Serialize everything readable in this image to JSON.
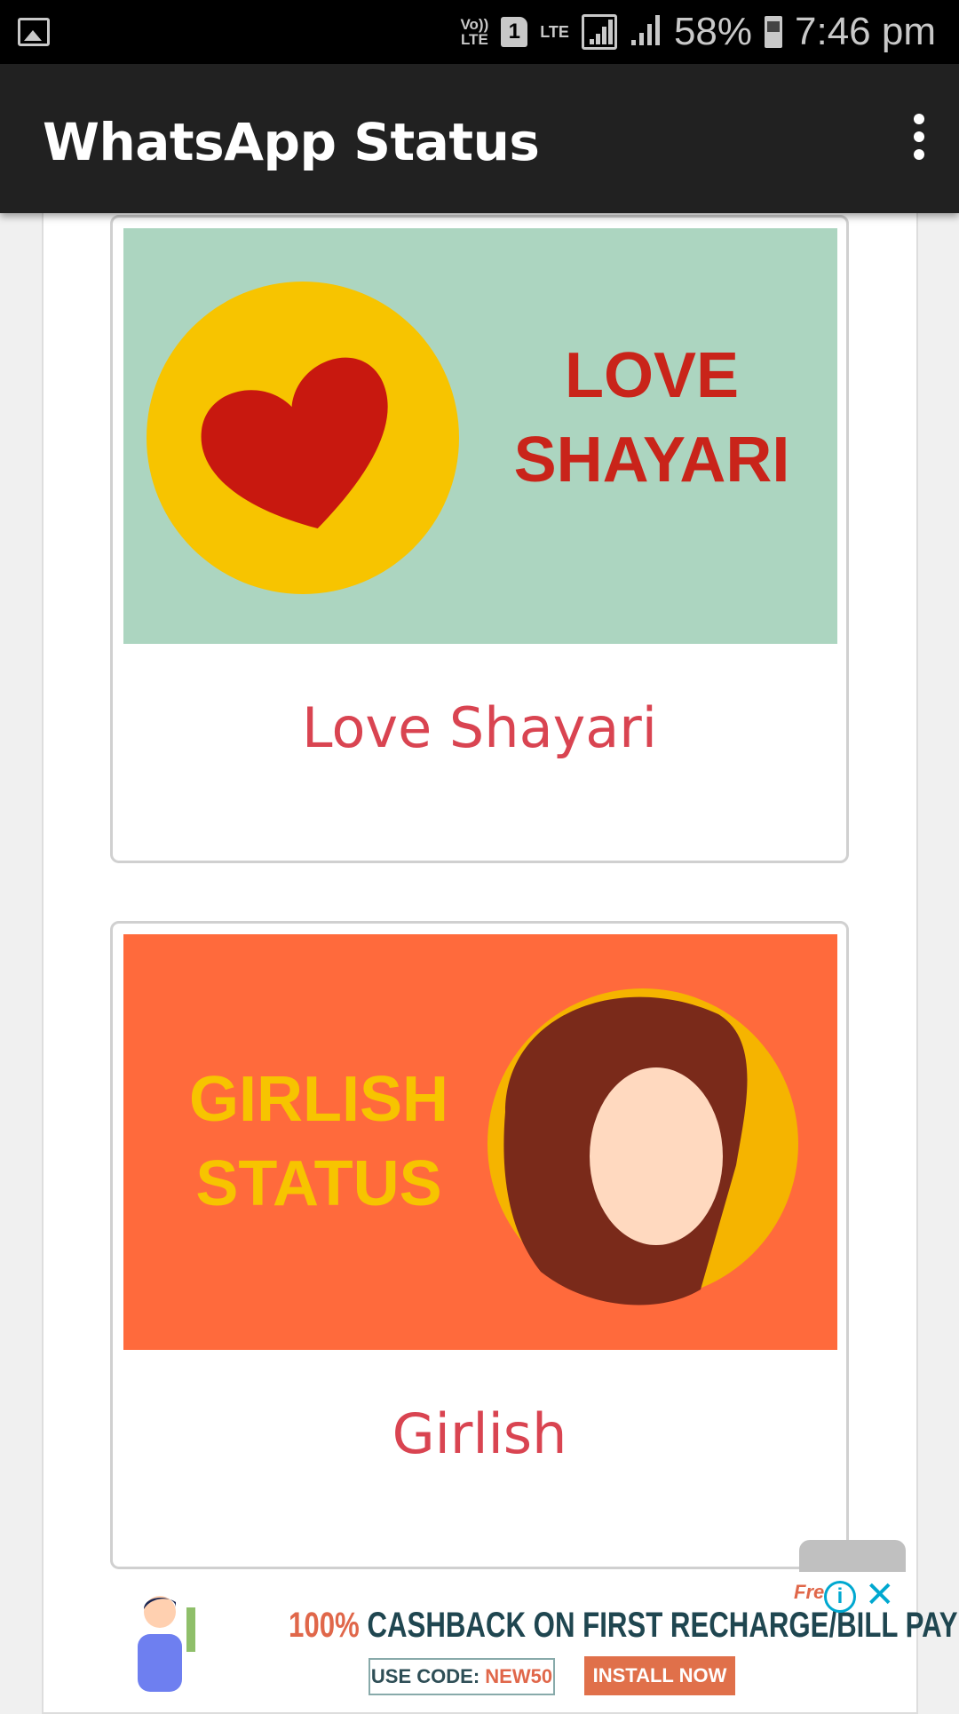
{
  "status_bar": {
    "volte": "Vo)) LTE",
    "sim": "1",
    "lte": "LTE",
    "battery": "58%",
    "time": "7:46 pm"
  },
  "app_bar": {
    "title": "WhatsApp Status"
  },
  "cards": [
    {
      "image_title_1": "LOVE",
      "image_title_2": "SHAYARI",
      "label": "Love Shayari",
      "bg": "#acd5c0"
    },
    {
      "image_title_1": "GIRLISH",
      "image_title_2": "STATUS",
      "label": "Girlish",
      "bg": "#ff6a3c"
    }
  ],
  "ad": {
    "headline_highlight": "100%",
    "headline": " CASHBACK ON FIRST RECHARGE/BILL PAY!",
    "code_label": "USE CODE: ",
    "code": "NEW50",
    "install": "INSTALL NOW",
    "brand": "Fre",
    "info": "i",
    "close": "✕"
  }
}
